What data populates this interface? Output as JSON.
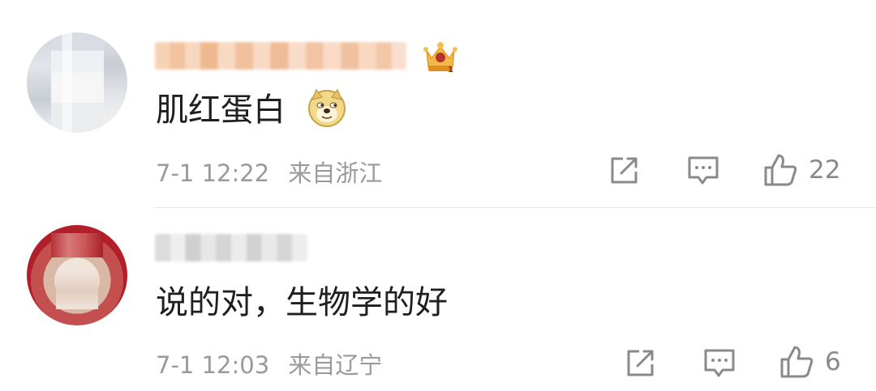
{
  "comments": [
    {
      "content": "肌红蛋白",
      "emoji": "doge-emoji",
      "badge_icon": "crown-badge-icon",
      "time": "7-1 12:22",
      "location": "来自浙江",
      "likes": "22"
    },
    {
      "content": "说的对，生物学的好",
      "time": "7-1 12:03",
      "location": "来自辽宁",
      "likes": "6"
    }
  ],
  "icons": {
    "share": "share-icon",
    "comment": "comment-icon",
    "like": "like-icon"
  },
  "colors": {
    "meta_text": "#9a9a9a",
    "icon": "#8a8a8a",
    "divider": "#e7e7e7",
    "badge_gold": "#e3a32e"
  }
}
